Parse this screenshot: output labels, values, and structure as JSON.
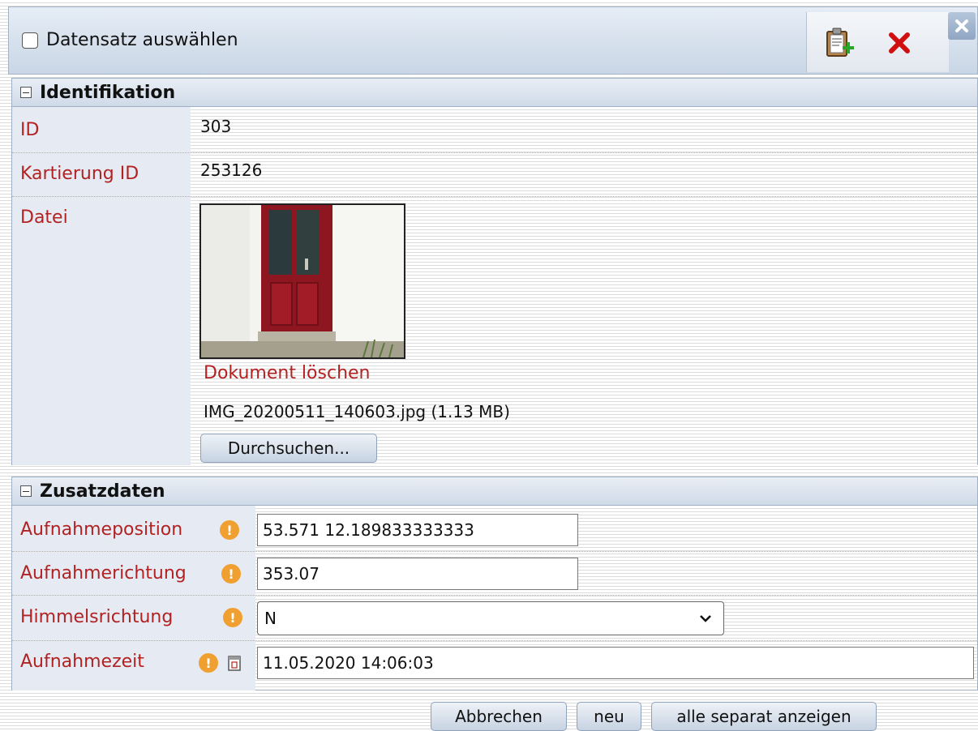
{
  "header": {
    "select_all_label": "Datensatz auswählen",
    "icons": [
      "clipboard-add-icon",
      "delete-x-icon",
      "close-icon"
    ]
  },
  "identifikation": {
    "title": "Identifikation",
    "rows": [
      {
        "label": "ID",
        "value": "303"
      },
      {
        "label": "Kartierung ID",
        "value": "253126"
      },
      {
        "label": "Datei",
        "value": ""
      }
    ],
    "delete_document_link": "Dokument löschen",
    "file_info": "IMG_20200511_140603.jpg (1.13 MB)",
    "browse_button": "Durchsuchen..."
  },
  "zusatzdaten": {
    "title": "Zusatzdaten",
    "aufnahmeposition": {
      "label": "Aufnahmeposition",
      "value": "53.571 12.189833333333"
    },
    "aufnahmerichtung": {
      "label": "Aufnahmerichtung",
      "value": "353.07"
    },
    "himmelsrichtung": {
      "label": "Himmelsrichtung",
      "selected": "N"
    },
    "aufnahmezeit": {
      "label": "Aufnahmezeit",
      "value": "11.05.2020 14:06:03"
    }
  },
  "footer": {
    "cancel_label": "Abbrechen",
    "new_label": "neu",
    "show_all_label": "alle separat anzeigen"
  },
  "colors": {
    "label_red": "#b22222",
    "warn_orange": "#f0a030",
    "header_blue": "#c9d6e5"
  }
}
